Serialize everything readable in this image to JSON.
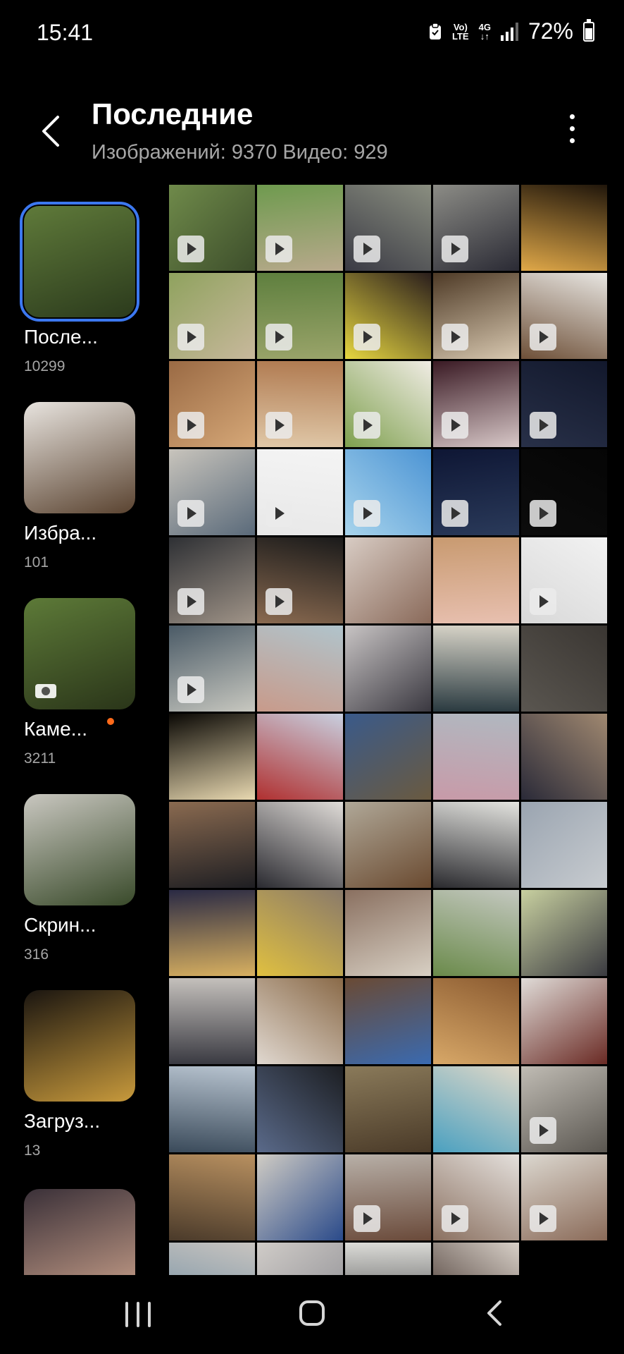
{
  "status_bar": {
    "time": "15:41",
    "volte_label": "Vo)) LTE",
    "network_label": "4G",
    "battery_percent": "72%",
    "battery_level": 0.72
  },
  "header": {
    "title": "Последние",
    "subtitle": "Изображений: 9370 Видео: 929"
  },
  "albums": [
    {
      "label": "После...",
      "count": "10299",
      "selected": true,
      "thumb_color": "#5f7a3a",
      "thumb_color2": "#2b3a1c"
    },
    {
      "label": "Избра...",
      "count": "101",
      "selected": false,
      "thumb_color": "#e8e4df",
      "thumb_color2": "#5a4330"
    },
    {
      "label": "Каме...",
      "count": "3211",
      "selected": false,
      "thumb_color": "#5d7a38",
      "thumb_color2": "#2a3519",
      "has_new_dot": true,
      "has_camera_icon": true
    },
    {
      "label": "Скрин...",
      "count": "316",
      "selected": false,
      "thumb_color": "#c9c7c0",
      "thumb_color2": "#394a2a"
    },
    {
      "label": "Загруз...",
      "count": "13",
      "selected": false,
      "thumb_color": "#1a1510",
      "thumb_color2": "#c89a3c"
    },
    {
      "label": "",
      "count": "",
      "selected": false,
      "thumb_color": "#3a3038",
      "thumb_color2": "#c9a08a"
    }
  ],
  "grid": {
    "thumbnails": [
      {
        "color": "#6f8a4a",
        "color2": "#3d4e2b",
        "video": true
      },
      {
        "color": "#6e9a4e",
        "color2": "#b8a98c",
        "video": true
      },
      {
        "color": "#8a8e80",
        "color2": "#3a3a44",
        "video": true
      },
      {
        "color": "#8c8c86",
        "color2": "#2a2a34",
        "video": true
      },
      {
        "color": "#20160b",
        "color2": "#e0a848",
        "video": false
      },
      {
        "color": "#8fa25e",
        "color2": "#c8b89c",
        "video": true
      },
      {
        "color": "#5e7f3e",
        "color2": "#9aa46a",
        "video": true
      },
      {
        "color": "#2a1e1c",
        "color2": "#e6d640",
        "video": true
      },
      {
        "color": "#4e3a26",
        "color2": "#d8c8b0",
        "video": true
      },
      {
        "color": "#e8e6e2",
        "color2": "#6e5038",
        "video": true
      },
      {
        "color": "#9a6a44",
        "color2": "#d6a878",
        "video": true
      },
      {
        "color": "#b07a50",
        "color2": "#e0c8a8",
        "video": true
      },
      {
        "color": "#f0ece4",
        "color2": "#7ea04e",
        "video": true
      },
      {
        "color": "#3a1a24",
        "color2": "#d8c8c8",
        "video": true
      },
      {
        "color": "#12182c",
        "color2": "#283048",
        "video": true
      },
      {
        "color": "#c8c4bc",
        "color2": "#5a6a7a",
        "video": true
      },
      {
        "color": "#f4f4f4",
        "color2": "#e8e8e8",
        "video": true
      },
      {
        "color": "#4c94d4",
        "color2": "#a8d4ec",
        "video": true
      },
      {
        "color": "#0e1634",
        "color2": "#2a3a5a",
        "video": true
      },
      {
        "color": "#050505",
        "color2": "#0c0c0c",
        "video": true
      },
      {
        "color": "#2e3034",
        "color2": "#a09488",
        "video": true
      },
      {
        "color": "#1a1a1a",
        "color2": "#8a6a50",
        "video": true
      },
      {
        "color": "#d8ccc4",
        "color2": "#8a6a5a",
        "video": false
      },
      {
        "color": "#c89a70",
        "color2": "#e8c0b0",
        "video": false
      },
      {
        "color": "#f2f2f2",
        "color2": "#d8d8d8",
        "video": true
      },
      {
        "color": "#4a5a66",
        "color2": "#c8c8c0",
        "video": true
      },
      {
        "color": "#b0c4cc",
        "color2": "#c89a8a",
        "video": false
      },
      {
        "color": "#c8c4c4",
        "color2": "#3a3840",
        "video": false
      },
      {
        "color": "#d8d4c8",
        "color2": "#2a3a40",
        "video": false
      },
      {
        "color": "#3a3632",
        "color2": "#5a5650",
        "video": false
      },
      {
        "color": "#0a0804",
        "color2": "#e8d8b0",
        "video": false
      },
      {
        "color": "#c8d0e0",
        "color2": "#b03030",
        "video": false
      },
      {
        "color": "#3a5a8a",
        "color2": "#6a5a40",
        "video": false
      },
      {
        "color": "#b0b8c0",
        "color2": "#c89aa8",
        "video": false
      },
      {
        "color": "#a08870",
        "color2": "#2a2a38",
        "video": false
      },
      {
        "color": "#8a6a50",
        "color2": "#1e1e22",
        "video": false
      },
      {
        "color": "#e0dcd8",
        "color2": "#2a2a30",
        "video": false
      },
      {
        "color": "#b0a898",
        "color2": "#6a4a30",
        "video": false
      },
      {
        "color": "#e4e4e0",
        "color2": "#2a2a2e",
        "video": false
      },
      {
        "color": "#9aa4b0",
        "color2": "#c8ccd0",
        "video": false
      },
      {
        "color": "#2a2a44",
        "color2": "#d8b060",
        "video": false
      },
      {
        "color": "#8a7a6a",
        "color2": "#e0c040",
        "video": false
      },
      {
        "color": "#8a7060",
        "color2": "#d8d0c4",
        "video": false
      },
      {
        "color": "#c4c8c0",
        "color2": "#6a8a4a",
        "video": false
      },
      {
        "color": "#c8d0a0",
        "color2": "#3a3a40",
        "video": false
      },
      {
        "color": "#c4c0bc",
        "color2": "#3a3a42",
        "video": false
      },
      {
        "color": "#8a6a48",
        "color2": "#e0d8d0",
        "video": false
      },
      {
        "color": "#6a4a34",
        "color2": "#3a6ab0",
        "video": false
      },
      {
        "color": "#8a5a30",
        "color2": "#d8a868",
        "video": false
      },
      {
        "color": "#e0dcd8",
        "color2": "#6a2a24",
        "video": false
      },
      {
        "color": "#b8c4d0",
        "color2": "#3a4a5a",
        "video": false
      },
      {
        "color": "#1c1e22",
        "color2": "#5a6a8a",
        "video": false
      },
      {
        "color": "#8a7a5a",
        "color2": "#4a3a28",
        "video": false
      },
      {
        "color": "#e0d8c8",
        "color2": "#4aa0c0",
        "video": false
      },
      {
        "color": "#c0bcb4",
        "color2": "#5a5650",
        "video": true
      },
      {
        "color": "#b89060",
        "color2": "#4a3a2a",
        "video": false
      },
      {
        "color": "#d0ccc4",
        "color2": "#2a4a8a",
        "video": false
      },
      {
        "color": "#b8b0a8",
        "color2": "#6a4a3a",
        "video": true
      },
      {
        "color": "#e4e0dc",
        "color2": "#8a7060",
        "video": true
      },
      {
        "color": "#dcd8d0",
        "color2": "#8a6a58",
        "video": true
      },
      {
        "color": "#c8c4c0",
        "color2": "#6a8aa0",
        "video": false
      },
      {
        "color": "#d0ccc8",
        "color2": "#8a8a90",
        "video": false
      },
      {
        "color": "#dcdcd8",
        "color2": "#3a3a3c",
        "video": false
      },
      {
        "color": "#d8d0c8",
        "color2": "#3a2a24",
        "video": false
      },
      {
        "color": "#000000",
        "color2": "#000000",
        "video": false
      }
    ]
  }
}
